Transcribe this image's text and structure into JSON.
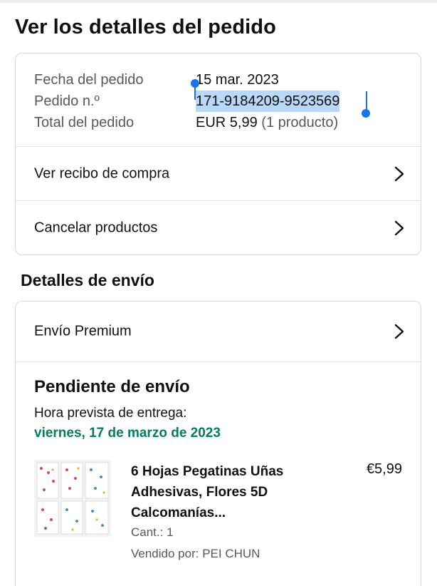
{
  "page_title": "Ver los detalles del pedido",
  "order_summary": {
    "date_label": "Fecha del pedido",
    "date_value": "15 mar. 2023",
    "number_label": "Pedido n.º",
    "number_value": "171-9184209-9523569",
    "total_label": "Total del pedido",
    "total_value": "EUR 5,99",
    "total_note": "(1 producto)"
  },
  "actions": {
    "receipt_label": "Ver recibo de compra",
    "cancel_label": "Cancelar productos"
  },
  "shipping": {
    "section_title": "Detalles de envío",
    "method_label": "Envío Premium",
    "status_title": "Pendiente de envío",
    "eta_label": "Hora prevista de entrega:",
    "eta_date": "viernes, 17 de marzo de 2023"
  },
  "product": {
    "title": "6 Hojas Pegatinas Uñas Adhesivas, Flores 5D Calcomanías...",
    "price": "€5,99",
    "quantity": "Cant.: 1",
    "seller": "Vendido por: PEI CHUN"
  },
  "icons": [
    "chevron-right-icon",
    "text-selection-handle"
  ],
  "colors": {
    "text": "#0f1111",
    "secondary": "#565959",
    "delivery_green": "#067d62",
    "selection": "#b9d8f7",
    "handle_blue": "#1a73e8",
    "border": "#d5d9d9"
  }
}
